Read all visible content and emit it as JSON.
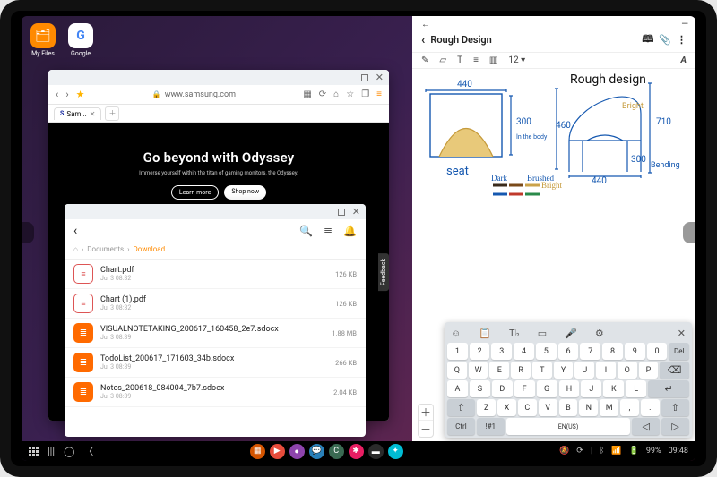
{
  "desktop": {
    "icons": [
      {
        "label": "My Files",
        "kind": "files"
      },
      {
        "label": "Google",
        "kind": "google"
      }
    ]
  },
  "browser": {
    "url": "www.samsung.com",
    "tab_label": "Sam...",
    "hero_title": "Go beyond with Odyssey",
    "hero_sub": "Immerse yourself within the titan of gaming monitors, the Odyssey.",
    "learn_more": "Learn more",
    "shop_now": "Shop now",
    "feedback": "Feedback"
  },
  "files": {
    "breadcrumb": [
      "Documents",
      "Download"
    ],
    "items": [
      {
        "name": "Chart.pdf",
        "date": "Jul 3 08:32",
        "size": "126 KB",
        "icon": "doc"
      },
      {
        "name": "Chart (1).pdf",
        "date": "Jul 3 08:32",
        "size": "126 KB",
        "icon": "doc"
      },
      {
        "name": "VISUALNOTETAKING_200617_160458_2e7.sdocx",
        "date": "Jul 3 08:39",
        "size": "1.88 MB",
        "icon": "sd"
      },
      {
        "name": "TodoList_200617_171603_34b.sdocx",
        "date": "Jul 3 08:39",
        "size": "266 KB",
        "icon": "sd"
      },
      {
        "name": "Notes_200618_084004_7b7.sdocx",
        "date": "Jul 3 08:39",
        "size": "2.04 KB",
        "icon": "sd"
      }
    ]
  },
  "notes": {
    "title": "Rough Design",
    "font_size": "12",
    "sketch": {
      "heading": "Rough design",
      "left_caption": "seat",
      "measurements": {
        "w": "440",
        "h_arrow_top": "300",
        "in_body": "In the body",
        "h_right": "710",
        "h_chair": "460",
        "depth": "300",
        "w_bottom": "440"
      },
      "labels": {
        "dark": "Dark",
        "brushed": "Brushed",
        "bright": "Bright",
        "bending": "Bending"
      }
    }
  },
  "keyboard": {
    "toolbar": [
      "☺",
      "📋",
      "T♭",
      "▭",
      "🎤",
      "⚙"
    ],
    "close": "✕",
    "rows": {
      "num": [
        "1",
        "2",
        "3",
        "4",
        "5",
        "6",
        "7",
        "8",
        "9",
        "0",
        "Del"
      ],
      "q": [
        "Q",
        "W",
        "E",
        "R",
        "T",
        "Y",
        "U",
        "I",
        "O",
        "P"
      ],
      "a": [
        "A",
        "S",
        "D",
        "F",
        "G",
        "H",
        "J",
        "K",
        "L"
      ],
      "z": [
        "Z",
        "X",
        "C",
        "V",
        "B",
        "N",
        "M"
      ],
      "shift": "⇧",
      "back": "⌫",
      "enter": "↵",
      "caret_l": "◁",
      "caret_r": "▷",
      "ctrl": "Ctrl",
      "sym": "!#1",
      "lang": "EN(US)"
    }
  },
  "taskbar": {
    "center_apps": [
      {
        "bg": "#d35400",
        "g": "▦"
      },
      {
        "bg": "#e74c3c",
        "g": "▶"
      },
      {
        "bg": "#8e44ad",
        "g": "●"
      },
      {
        "bg": "#2980b9",
        "g": "💬"
      },
      {
        "bg": "#3a6a52",
        "g": "C"
      },
      {
        "bg": "#e91e63",
        "g": "✱"
      },
      {
        "bg": "#2a2a2a",
        "g": "▬"
      },
      {
        "bg": "#00bcd4",
        "g": "✦"
      }
    ],
    "battery": "99%",
    "time": "09:48"
  }
}
